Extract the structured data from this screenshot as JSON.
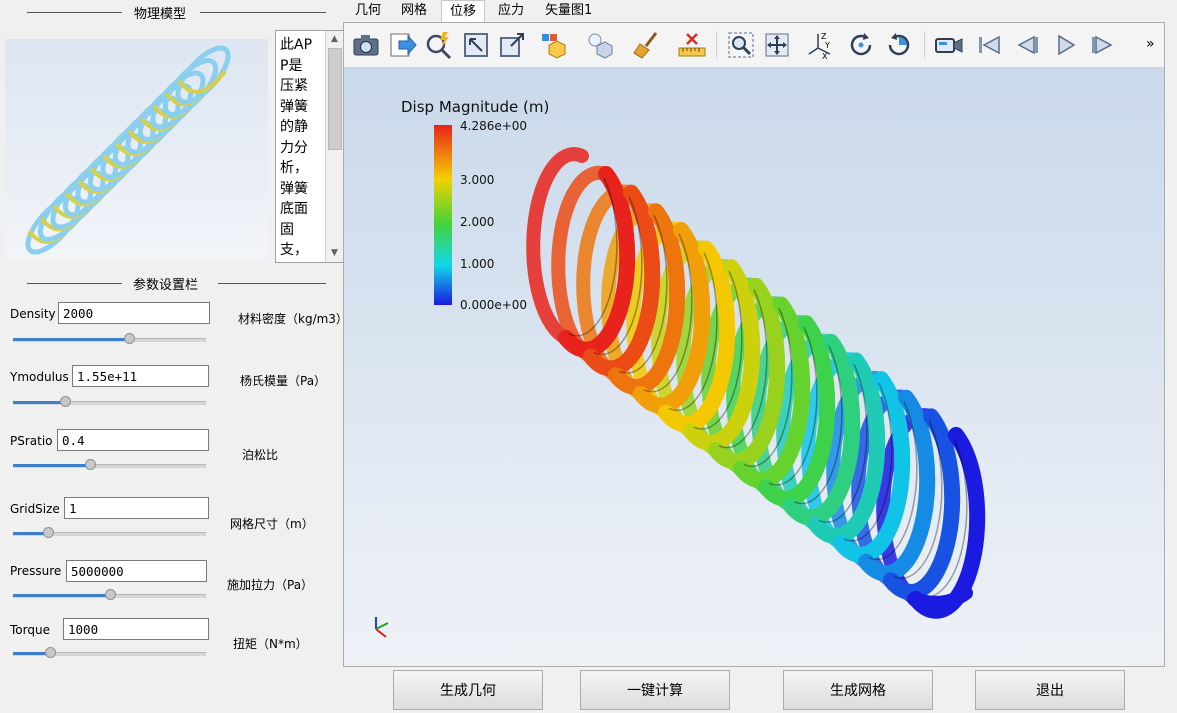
{
  "sidebar": {
    "model_section_title": "物理模型",
    "description": "此APP是压紧弹簧的静力分析，弹簧底面固支，顶面施",
    "params_section_title": "参数设置栏",
    "params": [
      {
        "label": "Density",
        "value": "2000",
        "unit": "材料密度（kg/m3）",
        "slider": 0.6
      },
      {
        "label": "Ymodulus",
        "value": "1.55e+11",
        "unit": "杨氏模量（Pa）",
        "slider": 0.27
      },
      {
        "label": "PSratio",
        "value": "0.4",
        "unit": "泊松比",
        "slider": 0.4
      },
      {
        "label": "GridSize",
        "value": "1",
        "unit": "网格尺寸（m）",
        "slider": 0.18
      },
      {
        "label": "Pressure",
        "value": "5000000",
        "unit": "施加拉力（Pa）",
        "slider": 0.5
      },
      {
        "label": "Torque",
        "value": "1000",
        "unit": "扭矩（N*m）",
        "slider": 0.19
      }
    ]
  },
  "tabs": [
    {
      "label": "几何",
      "active": false
    },
    {
      "label": "网格",
      "active": false
    },
    {
      "label": "位移",
      "active": true
    },
    {
      "label": "应力",
      "active": false
    },
    {
      "label": "矢量图1",
      "active": false
    }
  ],
  "toolbar": {
    "icons": [
      "camera-icon",
      "export-icon",
      "probe-icon",
      "zoom-box-icon",
      "fit-box-icon",
      "cube-color-icon",
      "light-icon",
      "broom-icon",
      "ruler-icon",
      "zoom-select-icon",
      "pan-icon",
      "axes-icon",
      "rotate-cw-icon",
      "reset-view-icon",
      "video-camera-icon",
      "first-frame-icon",
      "prev-frame-icon",
      "play-icon",
      "last-frame-icon"
    ],
    "overflow": "»"
  },
  "legend": {
    "title": "Disp Magnitude (m)",
    "max_label": "4.286e+00",
    "ticks": [
      "3.000",
      "2.000",
      "1.000"
    ],
    "min_label": "0.000e+00",
    "colors": {
      "high": "#e8231b",
      "mid_high": "#f4d000",
      "mid": "#42d33a",
      "mid_low": "#12d8e8",
      "low": "#1a1ae0"
    }
  },
  "buttons": {
    "generate_geometry": "生成几何",
    "one_click_compute": "一键计算",
    "generate_mesh": "生成网格",
    "exit": "退出"
  }
}
